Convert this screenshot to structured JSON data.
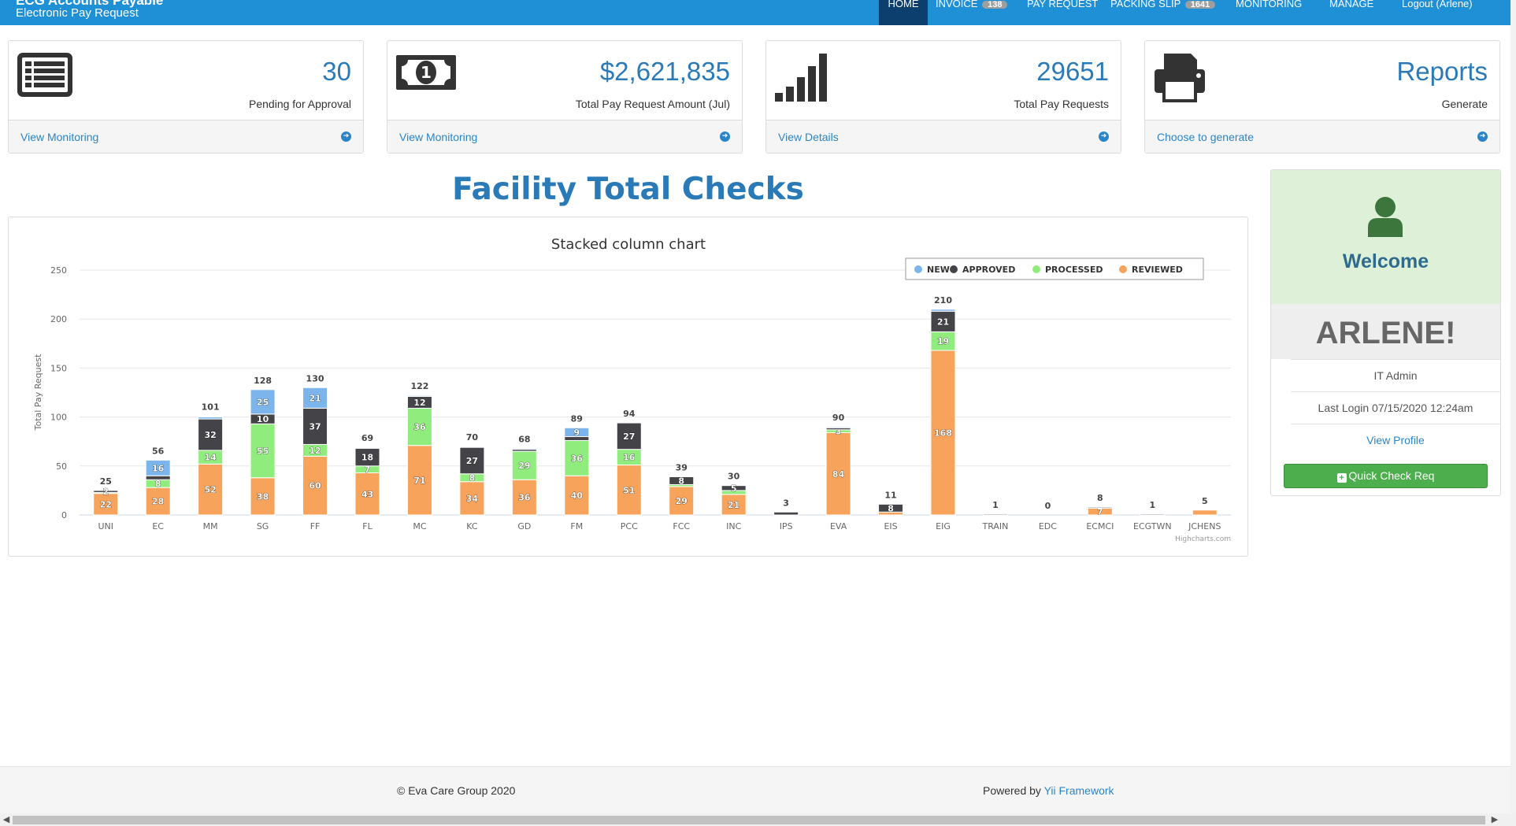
{
  "header": {
    "title": "ECG Accounts Payable",
    "subtitle": "Electronic Pay Request"
  },
  "nav": {
    "items": [
      {
        "label": "HOME"
      },
      {
        "label": "INVOICE",
        "badge": "138"
      },
      {
        "label": "PAY REQUEST"
      },
      {
        "label": "PACKING SLIP",
        "badge": "1641"
      },
      {
        "label": "MONITORING"
      },
      {
        "label": "MANAGE"
      },
      {
        "label": "Logout (Arlene)"
      }
    ]
  },
  "cards": [
    {
      "value": "30",
      "label": "Pending for Approval",
      "link": "View Monitoring",
      "icon": "list-icon"
    },
    {
      "value": "$2,621,835",
      "label": "Total Pay Request Amount (Jul)",
      "link": "View Monitoring",
      "icon": "money-icon"
    },
    {
      "value": "29651",
      "label": "Total Pay Requests",
      "link": "View Details",
      "icon": "signal-bars-icon"
    },
    {
      "value": "Reports",
      "label": "Generate",
      "link": "Choose to generate",
      "icon": "printer-icon"
    }
  ],
  "section_title": "Facility Total Checks",
  "chart_data": {
    "type": "bar",
    "stacked": true,
    "title": "Stacked column chart",
    "xlabel": "",
    "ylabel": "Total Pay Request",
    "ylim": [
      0,
      250
    ],
    "yticks": [
      0,
      50,
      100,
      150,
      200,
      250
    ],
    "grid": true,
    "legend_position": "top-right",
    "credit": "Highcharts.com",
    "categories": [
      "UNI",
      "EC",
      "MM",
      "SG",
      "FF",
      "FL",
      "MC",
      "KC",
      "GD",
      "FM",
      "PCC",
      "FCC",
      "INC",
      "IPS",
      "EVA",
      "EIS",
      "EIG",
      "TRAIN",
      "EDC",
      "ECMCI",
      "ECGTWN",
      "JCHENS"
    ],
    "totals": [
      25,
      56,
      101,
      128,
      130,
      69,
      122,
      70,
      68,
      89,
      94,
      39,
      30,
      3,
      90,
      11,
      210,
      1,
      0,
      8,
      1,
      5
    ],
    "series": [
      {
        "name": "NEW",
        "color": "#7cb5ec",
        "values": [
          0,
          16,
          2,
          25,
          21,
          0,
          1,
          0,
          1,
          9,
          0,
          0,
          0,
          0,
          1,
          0,
          2,
          0,
          0,
          0,
          0,
          0
        ]
      },
      {
        "name": "APPROVED",
        "color": "#434348",
        "values": [
          2,
          4,
          32,
          10,
          37,
          18,
          12,
          27,
          2,
          4,
          27,
          8,
          5,
          3,
          2,
          8,
          21,
          1,
          0,
          1,
          1,
          0
        ]
      },
      {
        "name": "PROCESSED",
        "color": "#90ed7d",
        "values": [
          1,
          8,
          14,
          55,
          12,
          7,
          38,
          8,
          29,
          36,
          16,
          2,
          4,
          0,
          3,
          0,
          19,
          0,
          0,
          0,
          0,
          0
        ]
      },
      {
        "name": "REVIEWED",
        "color": "#f7a35c",
        "values": [
          22,
          28,
          52,
          38,
          60,
          43,
          71,
          34,
          36,
          40,
          51,
          29,
          21,
          0,
          84,
          3,
          168,
          0,
          0,
          7,
          0,
          5
        ]
      }
    ],
    "data_labels": [
      {
        "NEW": "",
        "APPROVED": "2",
        "PROCESSED": "",
        "REVIEWED": "22"
      },
      {
        "NEW": "16",
        "APPROVED": "",
        "PROCESSED": "8",
        "REVIEWED": "28"
      },
      {
        "NEW": "",
        "APPROVED": "32",
        "PROCESSED": "14",
        "REVIEWED": "52"
      },
      {
        "NEW": "25",
        "APPROVED": "10",
        "PROCESSED": "55",
        "REVIEWED": "38"
      },
      {
        "NEW": "21",
        "APPROVED": "37",
        "PROCESSED": "12",
        "REVIEWED": "60"
      },
      {
        "NEW": "",
        "APPROVED": "18",
        "PROCESSED": "7",
        "REVIEWED": "43"
      },
      {
        "NEW": "",
        "APPROVED": "12",
        "PROCESSED": "36",
        "REVIEWED": "71"
      },
      {
        "NEW": "",
        "APPROVED": "27",
        "PROCESSED": "8",
        "REVIEWED": "34"
      },
      {
        "NEW": "",
        "APPROVED": "",
        "PROCESSED": "29",
        "REVIEWED": "36"
      },
      {
        "NEW": "9",
        "APPROVED": "",
        "PROCESSED": "36",
        "REVIEWED": "40"
      },
      {
        "NEW": "",
        "APPROVED": "27",
        "PROCESSED": "16",
        "REVIEWED": "51"
      },
      {
        "NEW": "",
        "APPROVED": "8",
        "PROCESSED": "",
        "REVIEWED": "29"
      },
      {
        "NEW": "",
        "APPROVED": "5",
        "PROCESSED": "",
        "REVIEWED": "21"
      },
      {
        "NEW": "",
        "APPROVED": "",
        "PROCESSED": "",
        "REVIEWED": ""
      },
      {
        "NEW": "",
        "APPROVED": "",
        "PROCESSED": "3",
        "REVIEWED": "84"
      },
      {
        "NEW": "",
        "APPROVED": "8",
        "PROCESSED": "",
        "REVIEWED": ""
      },
      {
        "NEW": "",
        "APPROVED": "21",
        "PROCESSED": "19",
        "REVIEWED": "168"
      },
      {
        "NEW": "",
        "APPROVED": "",
        "PROCESSED": "",
        "REVIEWED": ""
      },
      {
        "NEW": "",
        "APPROVED": "",
        "PROCESSED": "",
        "REVIEWED": ""
      },
      {
        "NEW": "",
        "APPROVED": "",
        "PROCESSED": "",
        "REVIEWED": "7"
      },
      {
        "NEW": "",
        "APPROVED": "",
        "PROCESSED": "",
        "REVIEWED": ""
      },
      {
        "NEW": "",
        "APPROVED": "",
        "PROCESSED": "",
        "REVIEWED": ""
      }
    ]
  },
  "welcome": {
    "greeting": "Welcome",
    "name": "ARLENE!",
    "role": "IT Admin",
    "last_login": "Last Login 07/15/2020 12:24am",
    "profile_link": "View Profile",
    "quick_button": "Quick Check Req"
  },
  "footer": {
    "copyright": "© Eva Care Group 2020",
    "powered_by": "Powered by",
    "framework": "Yii Framework"
  },
  "colors": {
    "topbar": "#1f8fd6",
    "nav_active": "#0d3f6e",
    "accent_blue": "#2a7ab8",
    "link": "#2a85c8",
    "welcome_bg": "#dff0d8",
    "button_green": "#4cae4c"
  }
}
